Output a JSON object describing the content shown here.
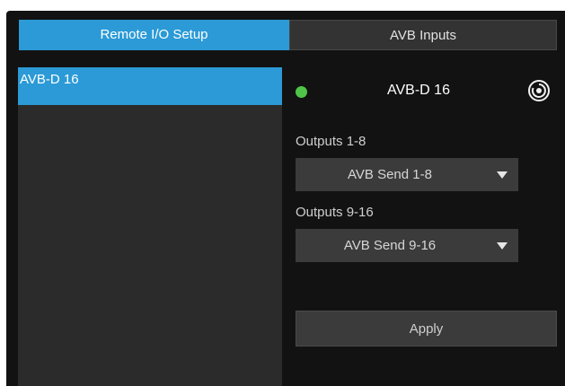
{
  "tabs": [
    {
      "label": "Remote I/O Setup"
    },
    {
      "label": "AVB Inputs"
    }
  ],
  "device_list": {
    "items": [
      {
        "label": "AVB-D 16"
      }
    ]
  },
  "device_panel": {
    "name": "AVB-D 16",
    "status_color": "#4fc548",
    "identify_icon": "identify-icon"
  },
  "outputs_1_8": {
    "label": "Outputs 1-8",
    "value": "AVB Send 1-8"
  },
  "outputs_9_16": {
    "label": "Outputs 9-16",
    "value": "AVB Send 9-16"
  },
  "apply_label": "Apply",
  "colors": {
    "accent": "#2b9ad7",
    "background": "#121212",
    "list_background": "#2b2b2b",
    "control_background": "#3b3b3b"
  }
}
